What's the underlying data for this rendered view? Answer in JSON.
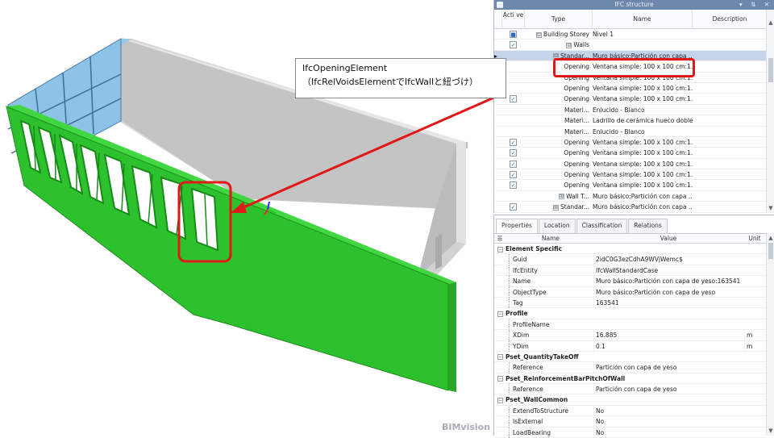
{
  "viewport": {
    "brand": "BIMvision"
  },
  "callout": {
    "line1": "IfcOpeningElement",
    "line2": "（IfcRelVoidsElementでIfcWallと紐づけ）"
  },
  "ifc_panel": {
    "title": "IFC structure",
    "window_controls": "▾ ⇅ ✕",
    "columns": {
      "active": "Acti ve",
      "type": "Type",
      "name": "Name",
      "description": "Description"
    },
    "rows": [
      {
        "check": "■",
        "expander": "⊟",
        "type": "Building Storey",
        "name": "Nivel 1"
      },
      {
        "check": "✓",
        "expander": "⊟",
        "type": "Walls",
        "name": ""
      },
      {
        "check": "",
        "expander": "⊟",
        "type": "Standar...",
        "name": "Muro básico:Partición con capa ..."
      },
      {
        "check": "",
        "expander": "",
        "type": "Opening",
        "name": "Ventana simple: 100 x 100 cm:1..."
      },
      {
        "check": "",
        "expander": "",
        "type": "Opening",
        "name": "Ventana simple: 100 x 100 cm:1..."
      },
      {
        "check": "",
        "expander": "",
        "type": "Opening",
        "name": "Ventana simple: 100 x 100 cm:1..."
      },
      {
        "check": "✓",
        "expander": "",
        "type": "Opening",
        "name": "Ventana simple: 100 x 100 cm:1..."
      },
      {
        "check": "",
        "expander": "",
        "type": "Materi...",
        "name": "Enlucido - Blanco"
      },
      {
        "check": "",
        "expander": "",
        "type": "Materi...",
        "name": "Ladrillo de cerámica hueco doble"
      },
      {
        "check": "",
        "expander": "",
        "type": "Materi...",
        "name": "Enlucido - Blanco"
      },
      {
        "check": "✓",
        "expander": "",
        "type": "Opening",
        "name": "Ventana simple: 100 x 100 cm:1..."
      },
      {
        "check": "✓",
        "expander": "",
        "type": "Opening",
        "name": "Ventana simple: 100 x 100 cm:1..."
      },
      {
        "check": "✓",
        "expander": "",
        "type": "Opening",
        "name": "Ventana simple: 100 x 100 cm:1..."
      },
      {
        "check": "✓",
        "expander": "",
        "type": "Opening",
        "name": "Ventana simple: 100 x 100 cm:1..."
      },
      {
        "check": "✓",
        "expander": "",
        "type": "Opening",
        "name": "Ventana simple: 100 x 100 cm:1..."
      },
      {
        "check": "",
        "expander": "⊞",
        "type": "Wall T...",
        "name": "Muro básico:Partición con capa ..."
      },
      {
        "check": "✓",
        "expander": "⊞",
        "type": "Standar...",
        "name": "Muro básico:Partición con capa ..."
      }
    ]
  },
  "properties_panel": {
    "tabs": [
      "Properties",
      "Location",
      "Classification",
      "Relations"
    ],
    "columns": {
      "name": "Name",
      "value": "Value",
      "unit": "Unit"
    },
    "rows": [
      {
        "group": "Element Specific"
      },
      {
        "name": "Guid",
        "value": "2idC0G3ezCdhA9WVjWemc$",
        "unit": ""
      },
      {
        "name": "IfcEntity",
        "value": "IfcWallStandardCase",
        "unit": ""
      },
      {
        "name": "Name",
        "value": "Muro básico:Partición con capa de yeso:163541",
        "unit": ""
      },
      {
        "name": "ObjectType",
        "value": "Muro básico:Partición con capa de yeso",
        "unit": ""
      },
      {
        "name": "Tag",
        "value": "163541",
        "unit": ""
      },
      {
        "group": "Profile"
      },
      {
        "name": "ProfileName",
        "value": "",
        "unit": ""
      },
      {
        "name": "XDim",
        "value": "16.885",
        "unit": "m"
      },
      {
        "name": "YDim",
        "value": "0.1",
        "unit": "m"
      },
      {
        "group": "Pset_QuantityTakeOff"
      },
      {
        "name": "Reference",
        "value": "Partición con capa de yeso",
        "unit": ""
      },
      {
        "group": "Pset_ReinforcementBarPitchOfWall"
      },
      {
        "name": "Reference",
        "value": "Partición con capa de yeso",
        "unit": ""
      },
      {
        "group": "Pset_WallCommon"
      },
      {
        "name": "ExtendToStructure",
        "value": "No",
        "unit": ""
      },
      {
        "name": "IsExternal",
        "value": "No",
        "unit": ""
      },
      {
        "name": "LoadBearing",
        "value": "No",
        "unit": ""
      }
    ]
  },
  "colors": {
    "selected_wall": "#2ec12e",
    "glass": "#8dc3e6",
    "highlight": "#e01818",
    "titlebar": "#6e87ad"
  }
}
